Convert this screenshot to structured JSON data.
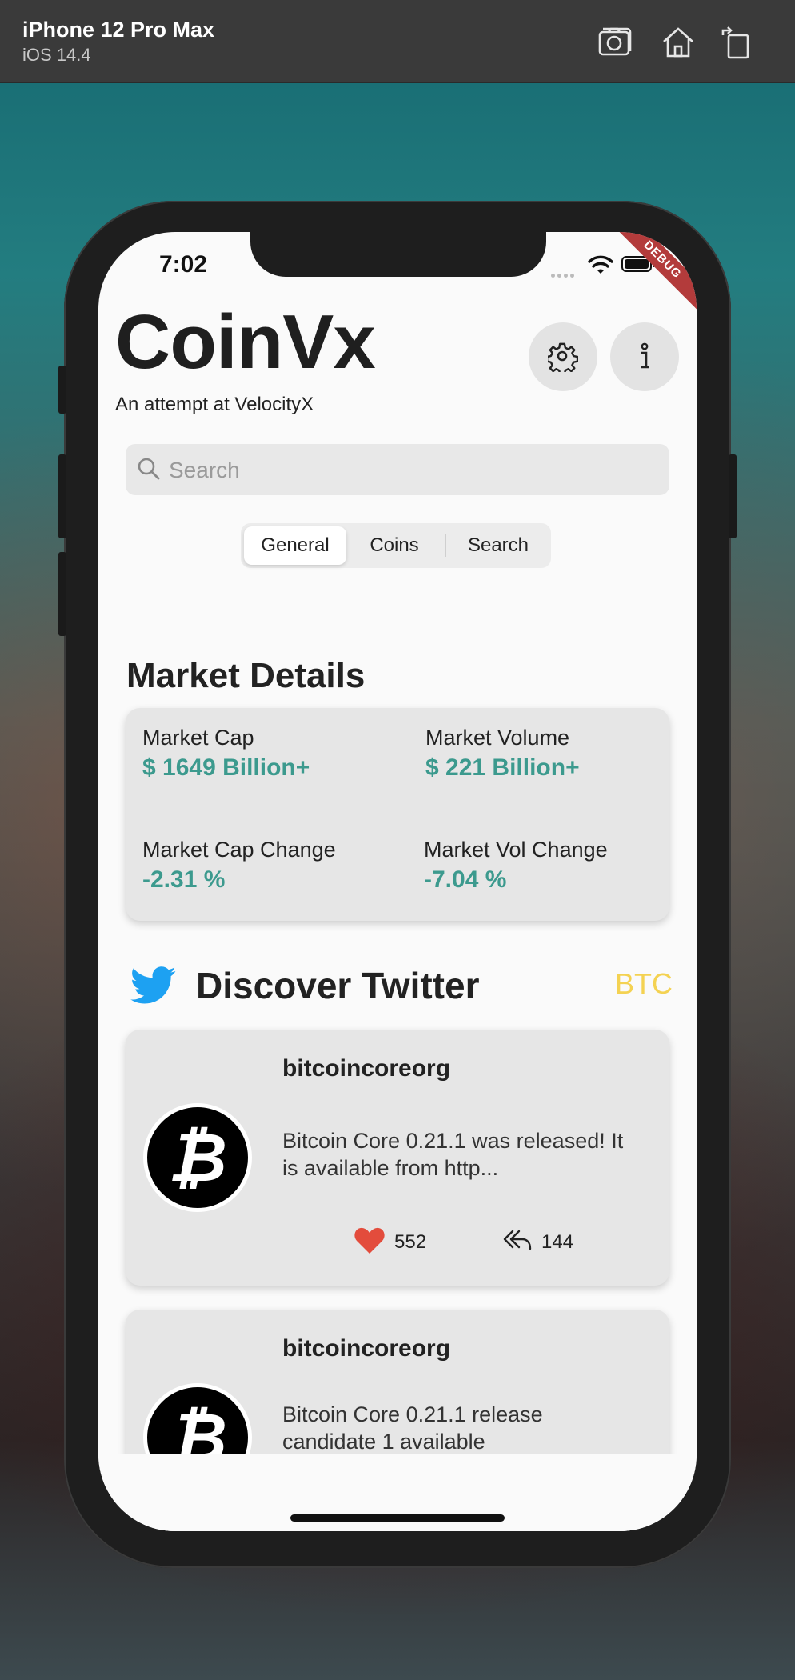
{
  "simulator": {
    "device": "iPhone 12 Pro Max",
    "os": "iOS 14.4",
    "icons": [
      "screenshot-icon",
      "home-icon",
      "rotate-icon"
    ]
  },
  "status_bar": {
    "time": "7:02",
    "debug_label": "DEBUG"
  },
  "app": {
    "title": "CoinVx",
    "subtitle": "An attempt at VelocityX"
  },
  "search": {
    "placeholder": "Search"
  },
  "tabs": [
    "General",
    "Coins",
    "Search"
  ],
  "active_tab": "General",
  "market": {
    "title": "Market Details",
    "stats": [
      {
        "label": "Market Cap",
        "value": "$ 1649 Billion+"
      },
      {
        "label": "Market Volume",
        "value": "$ 221 Billion+"
      },
      {
        "label": "Market Cap Change",
        "value": "-2.31 %"
      },
      {
        "label": "Market Vol Change",
        "value": "-7.04 %"
      }
    ],
    "value_color": "#3c9a8e"
  },
  "twitter": {
    "title": "Discover Twitter",
    "coin_filter": "BTC",
    "brand_color": "#1da1f2",
    "tweets": [
      {
        "user": "bitcoincoreorg",
        "text": "Bitcoin Core 0.21.1 was released! It is available from http...",
        "likes": "552",
        "retweets": "144"
      },
      {
        "user": "bitcoincoreorg",
        "text": "Bitcoin Core 0.21.1 release candidate 1 available"
      }
    ]
  }
}
